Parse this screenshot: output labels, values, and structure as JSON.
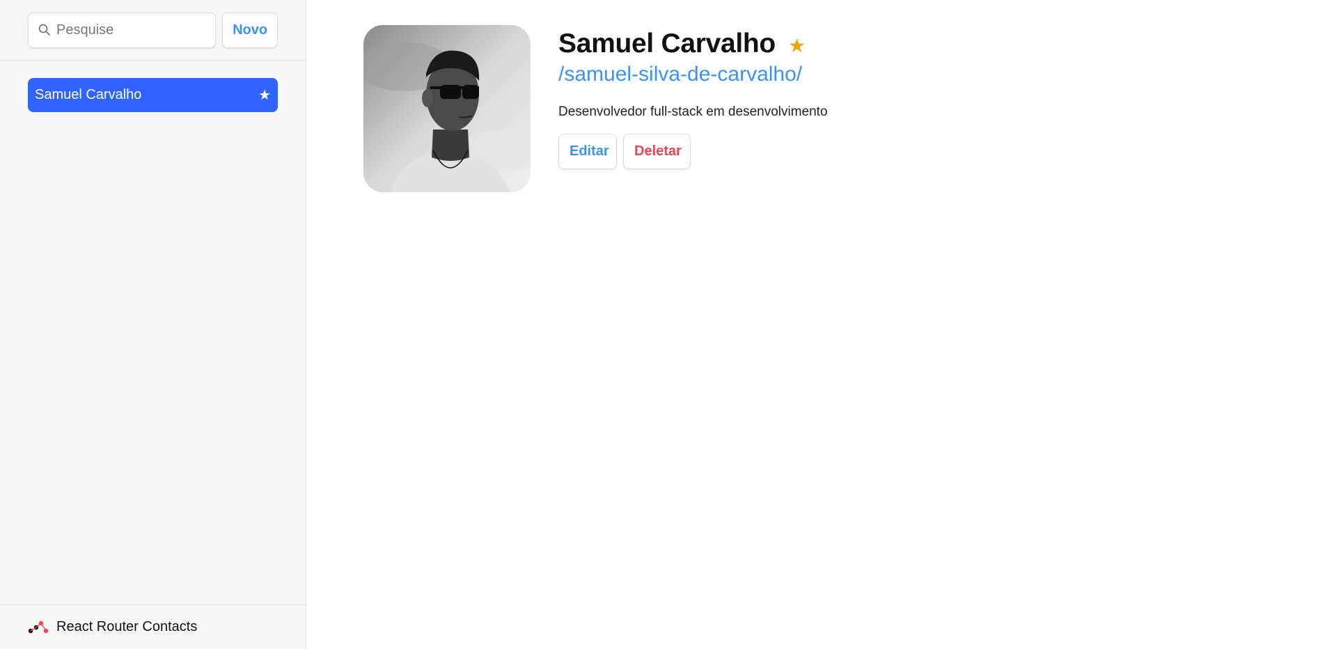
{
  "colors": {
    "accent": "#3992ff",
    "selected": "#2f64ff",
    "danger": "#f44250",
    "star": "#e9a809",
    "sidebar_bg": "#f7f7f7"
  },
  "sidebar": {
    "search": {
      "placeholder": "Pesquise",
      "value": "",
      "icon": "search-icon"
    },
    "new_label": "Novo",
    "contacts": [
      {
        "name": "Samuel Carvalho",
        "favorite": true,
        "favorite_glyph": "★",
        "selected": true
      }
    ],
    "footer": {
      "title": "React Router Contacts",
      "icon": "react-router-logo-icon"
    }
  },
  "detail": {
    "avatar": "avatar-photo",
    "name": "Samuel Carvalho",
    "favorite_glyph": "★",
    "twitter": "/samuel-silva-de-carvalho/",
    "notes": "Desenvolvedor full-stack em desenvolvimento",
    "edit_label": "Editar",
    "delete_label": "Deletar"
  }
}
